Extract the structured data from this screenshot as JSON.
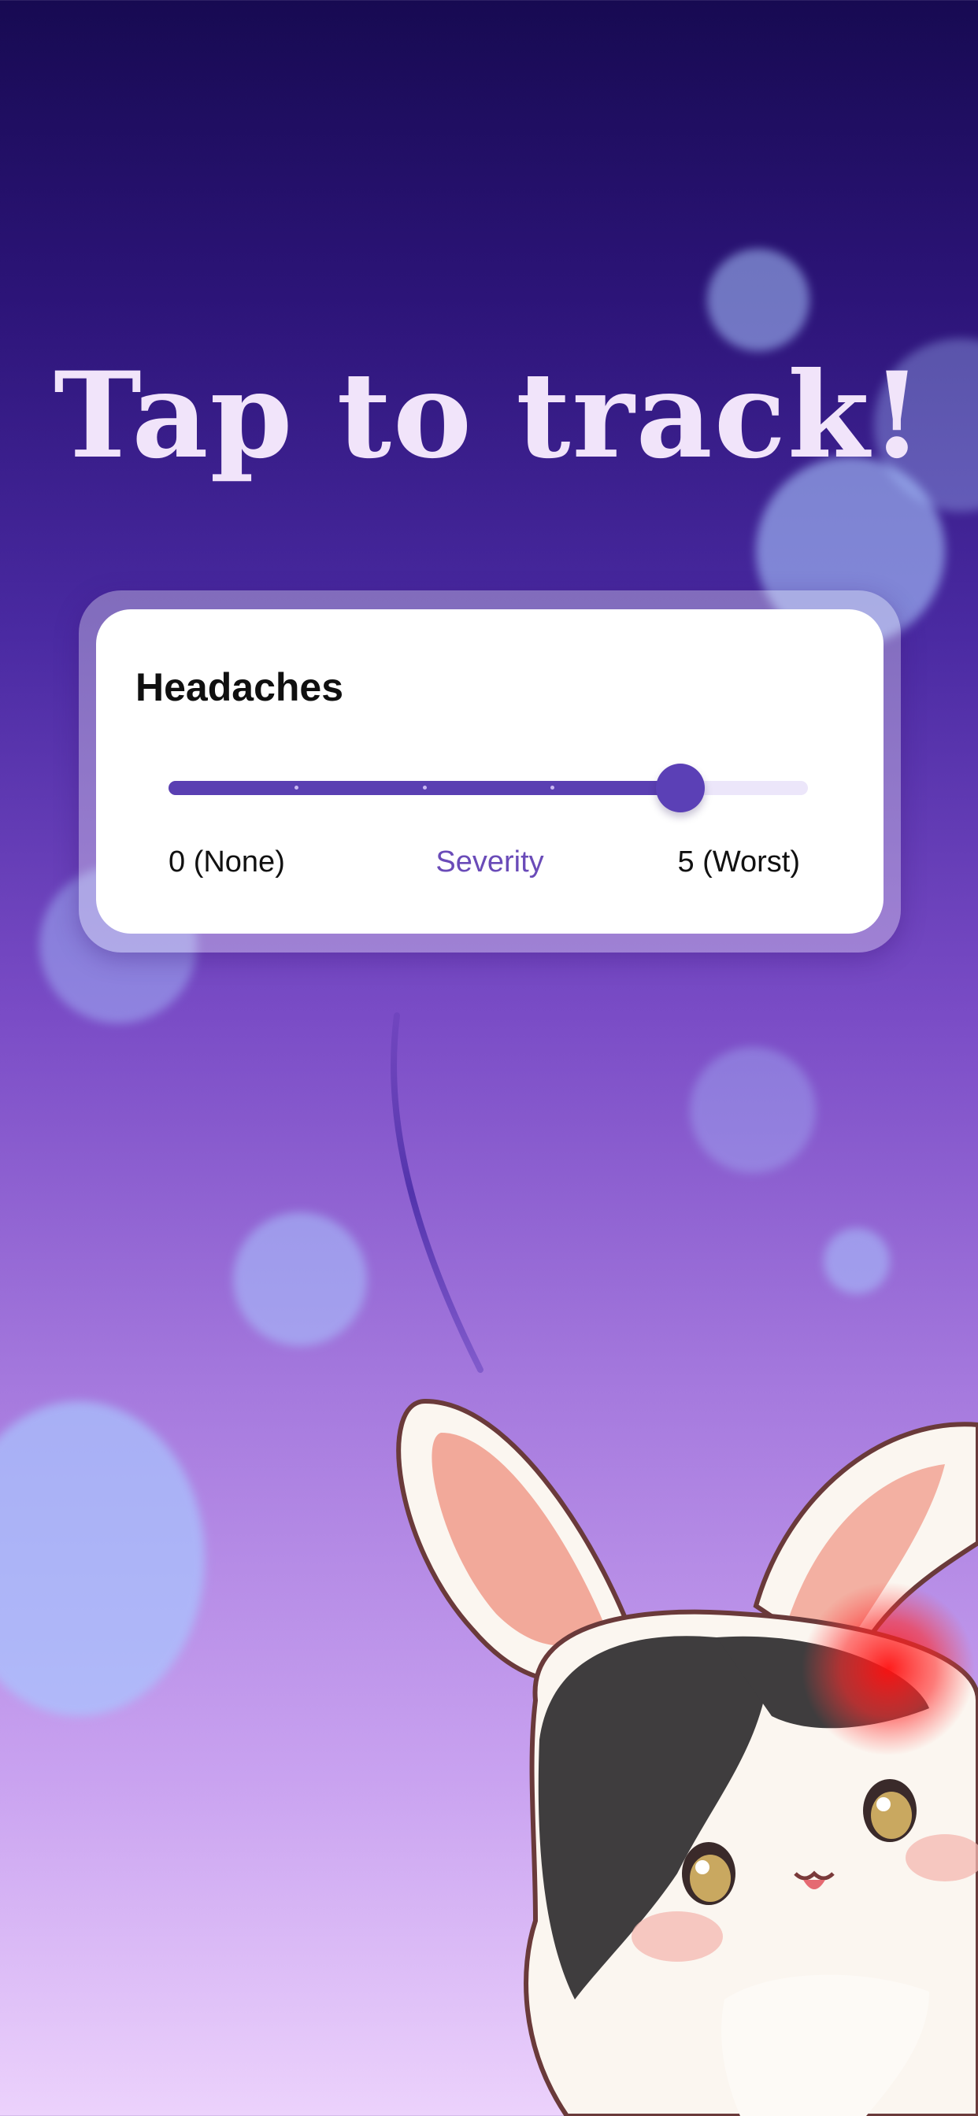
{
  "headline": "Tap to track!",
  "tracker": {
    "title": "Headaches",
    "slider": {
      "min_label": "0 (None)",
      "center_label": "Severity",
      "max_label": "5 (Worst)",
      "value": 4,
      "min": 0,
      "max": 5
    }
  },
  "colors": {
    "accent": "#5a3fb2",
    "headline": "#f1e4fa",
    "track_empty": "#ece6fa"
  },
  "illustration": "bunny-with-headache"
}
